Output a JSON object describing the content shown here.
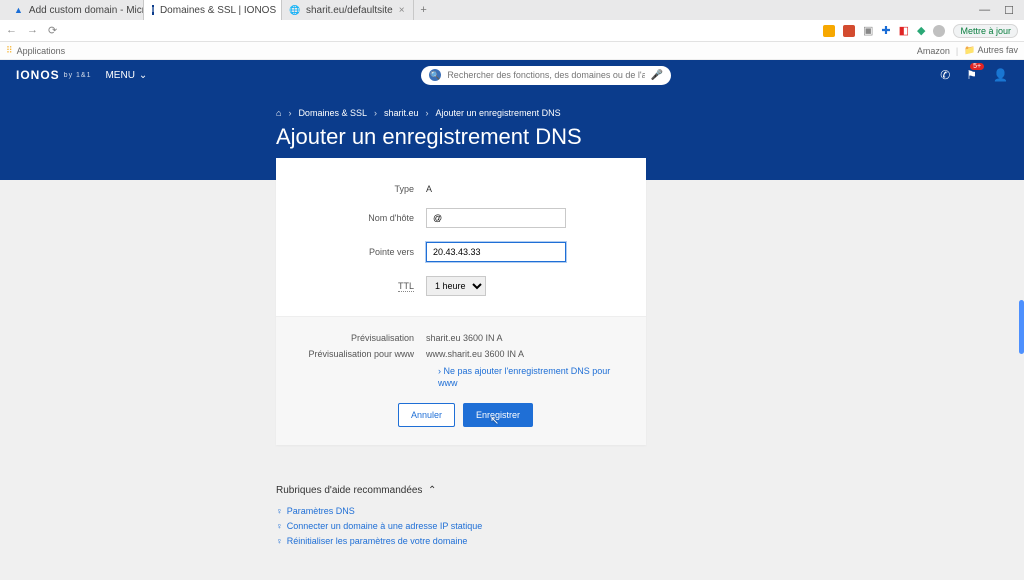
{
  "browser": {
    "tabs": [
      {
        "favicon_color": "#1a6dd6",
        "title": "Add custom domain - Microsoft"
      },
      {
        "favicon_color": "#0b3c8c",
        "title": "Domaines & SSL | IONOS"
      },
      {
        "favicon_color": "#cccccc",
        "title": "sharit.eu/defaultsite"
      }
    ],
    "update_label": "Mettre à jour",
    "apps_label": "Applications",
    "amazon_label": "Amazon",
    "autres_label": "Autres fav"
  },
  "header": {
    "logo": "IONOS",
    "logo_by": "by 1&1",
    "menu": "MENU",
    "search_placeholder": "Rechercher des fonctions, des domaines ou de l'aide",
    "badge": "5+"
  },
  "breadcrumbs": {
    "items": [
      "Domaines & SSL",
      "sharit.eu",
      "Ajouter un enregistrement DNS"
    ]
  },
  "page_title": "Ajouter un enregistrement DNS",
  "form": {
    "type_label": "Type",
    "type_value": "A",
    "host_label": "Nom d'hôte",
    "host_value": "@",
    "points_label": "Pointe vers",
    "points_value": "20.43.43.33",
    "ttl_label": "TTL",
    "ttl_value": "1 heure"
  },
  "preview": {
    "pv_label": "Prévisualisation",
    "pv_value": "sharit.eu  3600  IN  A",
    "pvw_label": "Prévisualisation pour www",
    "pvw_value": "www.sharit.eu  3600  IN  A",
    "skip_link": "Ne pas ajouter l'enregistrement DNS pour www"
  },
  "buttons": {
    "cancel": "Annuler",
    "save": "Enregistrer"
  },
  "help": {
    "title": "Rubriques d'aide recommandées",
    "items": [
      "Paramètres DNS",
      "Connecter un domaine à une adresse IP statique",
      "Réinitialiser les paramètres de votre domaine"
    ]
  }
}
